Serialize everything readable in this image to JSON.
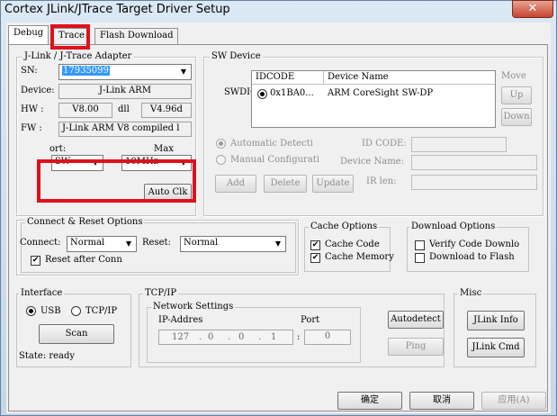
{
  "window": {
    "title": "Cortex JLink/JTrace Target Driver Setup",
    "close_glyph": "✕"
  },
  "tabs": [
    {
      "label": "Debug"
    },
    {
      "label": "Trace"
    },
    {
      "label": "Flash Download"
    }
  ],
  "jlink": {
    "group": "J-Link / J-Trace Adapter",
    "sn_label": "SN:",
    "sn_value": "17935099",
    "device_label": "Device:",
    "device_value": "J-Link ARM",
    "hw_label": "HW :",
    "hw_value": "V8.00",
    "dll_label": "dll",
    "dll_value": "V4.96d",
    "fw_label": "FW :",
    "fw_value": "J-Link ARM V8 compiled l",
    "port_label": "ort:",
    "port_value": "SW",
    "max_label": "Max",
    "max_value": "10MHz",
    "autoclk_label": "Auto Clk"
  },
  "sw_device": {
    "group": "SW Device",
    "swdio_label": "SWDIO",
    "col_idcode": "IDCODE",
    "col_devname": "Device Name",
    "row_idcode": "0x1BA0...",
    "row_devname": "ARM CoreSight SW-DP",
    "move_label": "Move",
    "up_label": "Up",
    "down_label": "Down",
    "auto_detect_label": "Automatic Detecti",
    "manual_config_label": "Manual Configurati",
    "idcode_label": "ID CODE:",
    "devname_label": "Device Name:",
    "irlen_label": "IR len:",
    "add_label": "Add",
    "delete_label": "Delete",
    "update_label": "Update"
  },
  "connect": {
    "group": "Connect & Reset Options",
    "connect_label": "Connect:",
    "connect_value": "Normal",
    "reset_label": "Reset:",
    "reset_value": "Normal",
    "reset_after_label": "Reset after Conn"
  },
  "cache": {
    "group": "Cache Options",
    "cache_code": "Cache Code",
    "cache_memory": "Cache Memory"
  },
  "download": {
    "group": "Download Options",
    "verify": "Verify Code Downlo",
    "download_flash": "Download to Flash"
  },
  "interface": {
    "group": "Interface",
    "usb": "USB",
    "tcpip": "TCP/IP",
    "scan": "Scan",
    "state": "State: ready"
  },
  "tcpip": {
    "group": "TCP/IP",
    "network": "Network Settings",
    "ip_label": "IP-Addres",
    "port_label": "Port",
    "ip": [
      "127",
      "0",
      "0",
      "1"
    ],
    "port": "0",
    "autodetect": "Autodetect",
    "ping": "Ping"
  },
  "misc": {
    "group": "Misc",
    "jlink_info": "JLink Info",
    "jlink_cmd": "JLink Cmd"
  },
  "footer": {
    "ok": "确定",
    "cancel": "取消",
    "apply": "应用(A)"
  },
  "colors": {
    "highlight": "#e0101c",
    "selection": "#3399ff"
  }
}
